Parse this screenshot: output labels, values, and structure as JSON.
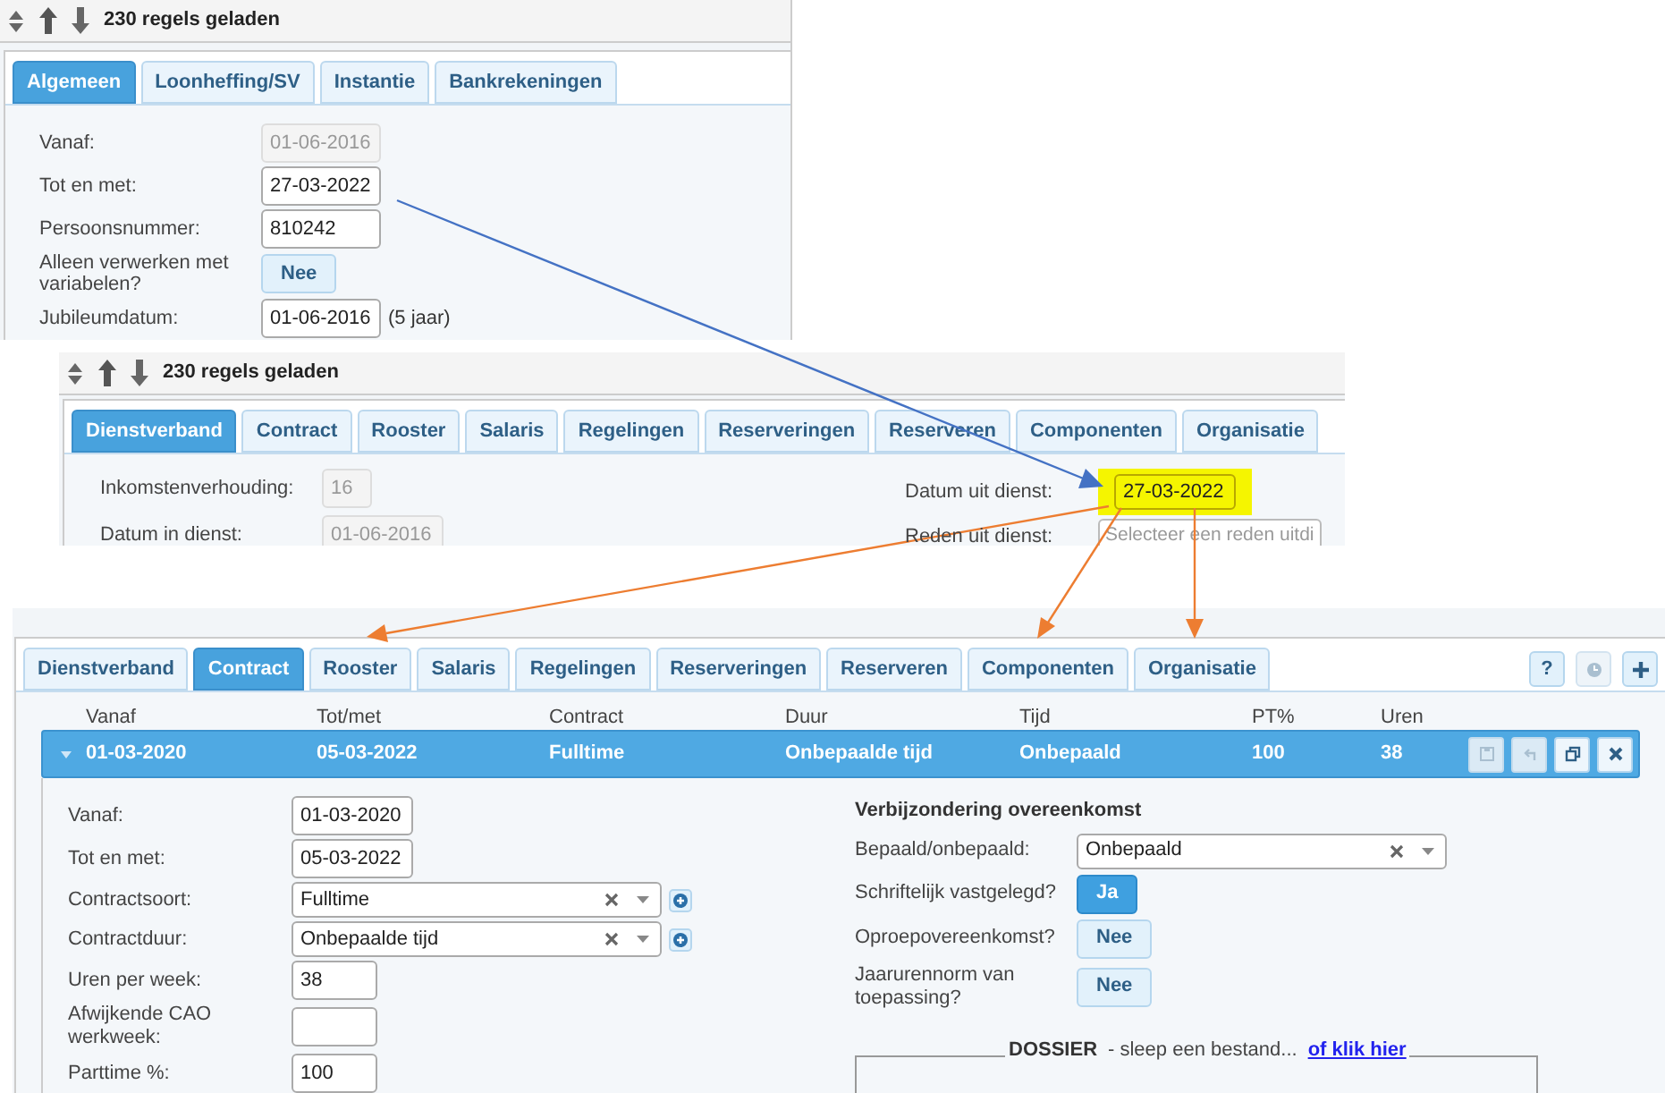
{
  "personal_panel": {
    "status": "230 regels geladen",
    "tabs": [
      {
        "label": "Algemeen",
        "selected": true
      },
      {
        "label": "Loonheffing/SV",
        "selected": false
      },
      {
        "label": "Instantie",
        "selected": false
      },
      {
        "label": "Bankrekeningen",
        "selected": false
      }
    ],
    "fields": [
      {
        "label": "Vanaf:",
        "kind": "text",
        "value": "01-06-2016",
        "disabled": true
      },
      {
        "label": "Tot en met:",
        "kind": "text",
        "value": "27-03-2022",
        "disabled": false
      },
      {
        "label": "Persoonsnummer:",
        "kind": "text",
        "value": "810242",
        "disabled": false
      },
      {
        "label": "Alleen verwerken met variabelen?",
        "kind": "toggle",
        "value": "Nee",
        "on": false
      },
      {
        "label": "Jubileumdatum:",
        "kind": "text",
        "value": "01-06-2016",
        "disabled": false,
        "suffix": "(5 jaar)"
      }
    ]
  },
  "employment_panel": {
    "status": "230 regels geladen",
    "tabs": [
      {
        "label": "Dienstverband",
        "selected": true
      },
      {
        "label": "Contract",
        "selected": false
      },
      {
        "label": "Rooster",
        "selected": false
      },
      {
        "label": "Salaris",
        "selected": false
      },
      {
        "label": "Regelingen",
        "selected": false
      },
      {
        "label": "Reserveringen",
        "selected": false
      },
      {
        "label": "Reserveren",
        "selected": false
      },
      {
        "label": "Componenten",
        "selected": false
      },
      {
        "label": "Organisatie",
        "selected": false
      }
    ],
    "left_fields": [
      {
        "label": "Inkomstenverhouding:",
        "value": "16",
        "disabled": true
      },
      {
        "label": "Datum in dienst:",
        "value": "01-06-2016",
        "disabled": true
      }
    ],
    "right_fields": [
      {
        "label": "Datum uit dienst:",
        "kind": "text",
        "value": "27-03-2022",
        "highlighted": true
      },
      {
        "label": "Reden uit dienst:",
        "kind": "select",
        "placeholder": "Selecteer een reden uitdi",
        "highlighted": false
      }
    ]
  },
  "contract_panel": {
    "tabs": [
      {
        "label": "Dienstverband",
        "selected": false
      },
      {
        "label": "Contract",
        "selected": true
      },
      {
        "label": "Rooster",
        "selected": false
      },
      {
        "label": "Salaris",
        "selected": false
      },
      {
        "label": "Regelingen",
        "selected": false
      },
      {
        "label": "Reserveringen",
        "selected": false
      },
      {
        "label": "Reserveren",
        "selected": false
      },
      {
        "label": "Componenten",
        "selected": false
      },
      {
        "label": "Organisatie",
        "selected": false
      }
    ],
    "toolbar_buttons": [
      {
        "kind": "help",
        "label": "?",
        "disabled": false
      },
      {
        "kind": "clock",
        "disabled": true
      },
      {
        "kind": "plus",
        "disabled": false
      }
    ],
    "columns": [
      "Vanaf",
      "Tot/met",
      "Contract",
      "Duur",
      "Tijd",
      "PT%",
      "Uren"
    ],
    "rows": [
      {
        "cells": [
          "01-03-2020",
          "05-03-2022",
          "Fulltime",
          "Onbepaalde tijd",
          "Onbepaald",
          "100",
          "38"
        ],
        "selected": true,
        "expanded": true
      }
    ],
    "row_actions": [
      {
        "kind": "save",
        "disabled": true
      },
      {
        "kind": "undo",
        "disabled": true
      },
      {
        "kind": "copy",
        "disabled": false
      },
      {
        "kind": "delete",
        "disabled": false
      }
    ],
    "form_left": [
      {
        "label": "Vanaf:",
        "kind": "text",
        "value": "01-03-2020"
      },
      {
        "label": "Tot en met:",
        "kind": "text",
        "value": "05-03-2022"
      },
      {
        "label": "Contractsoort:",
        "kind": "select",
        "value": "Fulltime"
      },
      {
        "label": "Contractduur:",
        "kind": "select",
        "value": "Onbepaalde tijd"
      },
      {
        "label": "Uren per week:",
        "kind": "text",
        "value": "38"
      },
      {
        "label": "Afwijkende CAO werkweek:",
        "kind": "text"
      },
      {
        "label": "Parttime %:",
        "kind": "text",
        "value": "100"
      }
    ],
    "section_title": "Verbijzondering overeenkomst",
    "form_right": [
      {
        "label": "Bepaald/onbepaald:",
        "kind": "select",
        "value": "Onbepaald"
      },
      {
        "label": "Schriftelijk vastgelegd?",
        "kind": "toggle",
        "value": "Ja",
        "on": true
      },
      {
        "label": "Oproepovereenkomst?",
        "kind": "toggle",
        "value": "Nee",
        "on": false
      },
      {
        "label": "Jaarurennorm van toepassing?",
        "kind": "toggle",
        "value": "Nee",
        "on": false
      }
    ],
    "dossier": {
      "title": "DOSSIER",
      "hint": "- sleep een bestand...",
      "link": "of klik hier"
    }
  }
}
